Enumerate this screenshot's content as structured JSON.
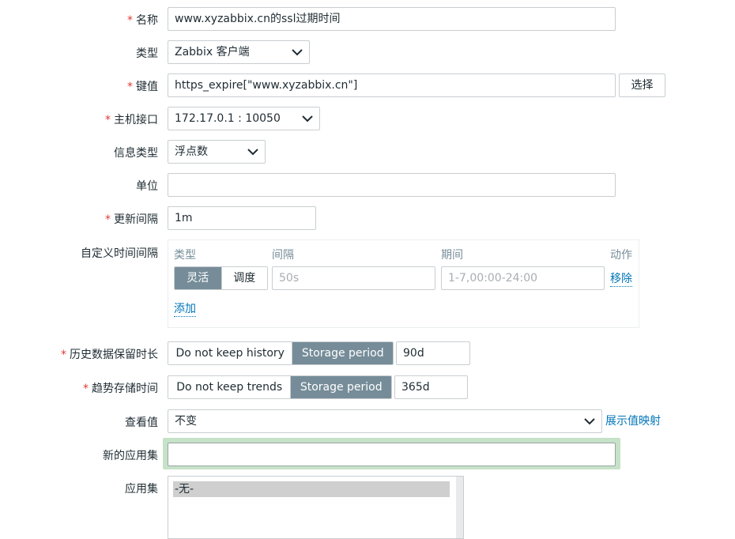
{
  "form": {
    "name": {
      "label": "名称",
      "value": "www.xyzabbix.cn的ssl过期时间"
    },
    "type": {
      "label": "类型",
      "value": "Zabbix 客户端"
    },
    "key": {
      "label": "键值",
      "value": "https_expire[\"www.xyzabbix.cn\"]",
      "select_button": "选择"
    },
    "host_interface": {
      "label": "主机接口",
      "value": "172.17.0.1 : 10050"
    },
    "info_type": {
      "label": "信息类型",
      "value": "浮点数"
    },
    "units": {
      "label": "单位",
      "value": ""
    },
    "update_interval": {
      "label": "更新间隔",
      "value": "1m"
    },
    "custom_intervals": {
      "label": "自定义时间间隔",
      "headers": {
        "type": "类型",
        "interval": "间隔",
        "period": "期间",
        "action": "动作"
      },
      "row": {
        "mode_options": [
          "灵活",
          "调度"
        ],
        "selected_mode": "灵活",
        "interval_placeholder": "50s",
        "period_placeholder": "1-7,00:00-24:00",
        "remove": "移除"
      },
      "add": "添加"
    },
    "history": {
      "label": "历史数据保留时长",
      "options": [
        "Do not keep history",
        "Storage period"
      ],
      "selected": "Storage period",
      "value": "90d"
    },
    "trends": {
      "label": "趋势存储时间",
      "options": [
        "Do not keep trends",
        "Storage period"
      ],
      "selected": "Storage period",
      "value": "365d"
    },
    "show_value": {
      "label": "查看值",
      "value": "不变",
      "link": "展示值映射"
    },
    "new_application": {
      "label": "新的应用集",
      "value": ""
    },
    "applications": {
      "label": "应用集",
      "items": [
        "-无-"
      ]
    }
  },
  "colors": {
    "required": "#e33734",
    "link": "#0275b8",
    "segment_active": "#768d99",
    "focus_outline": "#c6e2c8"
  }
}
